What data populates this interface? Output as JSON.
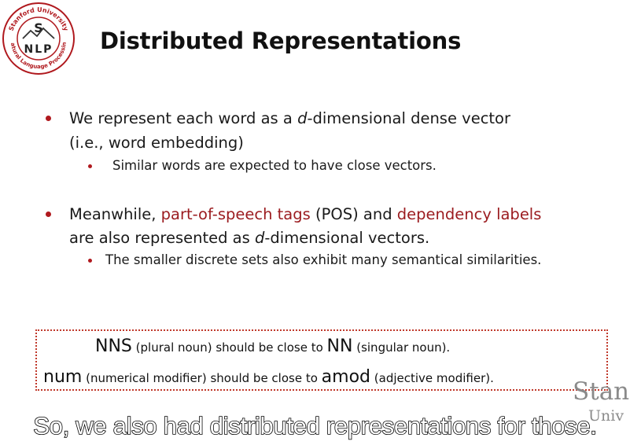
{
  "logo": {
    "ring_top": "Stanford University",
    "ring_bottom": "Natural Language Processing",
    "center_top": "S",
    "center_bottom": "NLP",
    "color": "#b0191e"
  },
  "title": "Distributed Representations",
  "bullets": [
    {
      "line1_a": "We represent each word as a ",
      "line1_d": "d",
      "line1_b": "-dimensional dense vector",
      "line2": "(i.e., word embedding)",
      "sub": "Similar words are expected to have close vectors."
    },
    {
      "line1_a": "Meanwhile, ",
      "line1_red1": "part-of-speech tags",
      "line1_b": " (POS) and ",
      "line1_red2": "dependency labels",
      "line2_a": "are also represented as ",
      "line2_d": "d",
      "line2_b": "-dimensional vectors.",
      "sub": "The smaller discrete sets also exhibit many semantical similarities."
    }
  ],
  "box": {
    "row1_term1": "NNS",
    "row1_desc1": " (plural noun) should be close to ",
    "row1_term2": "NN",
    "row1_desc2": " (singular noun).",
    "row2_term1": "num",
    "row2_desc1": " (numerical modifier) should be close to ",
    "row2_term2": "amod",
    "row2_desc2": " (adjective modifier)."
  },
  "watermark": {
    "line1": "Stan",
    "line2": "Univ"
  },
  "caption": "So, we also had distributed representations for those.",
  "colors": {
    "accent": "#b0191e",
    "link_red": "#9b1b1f"
  }
}
